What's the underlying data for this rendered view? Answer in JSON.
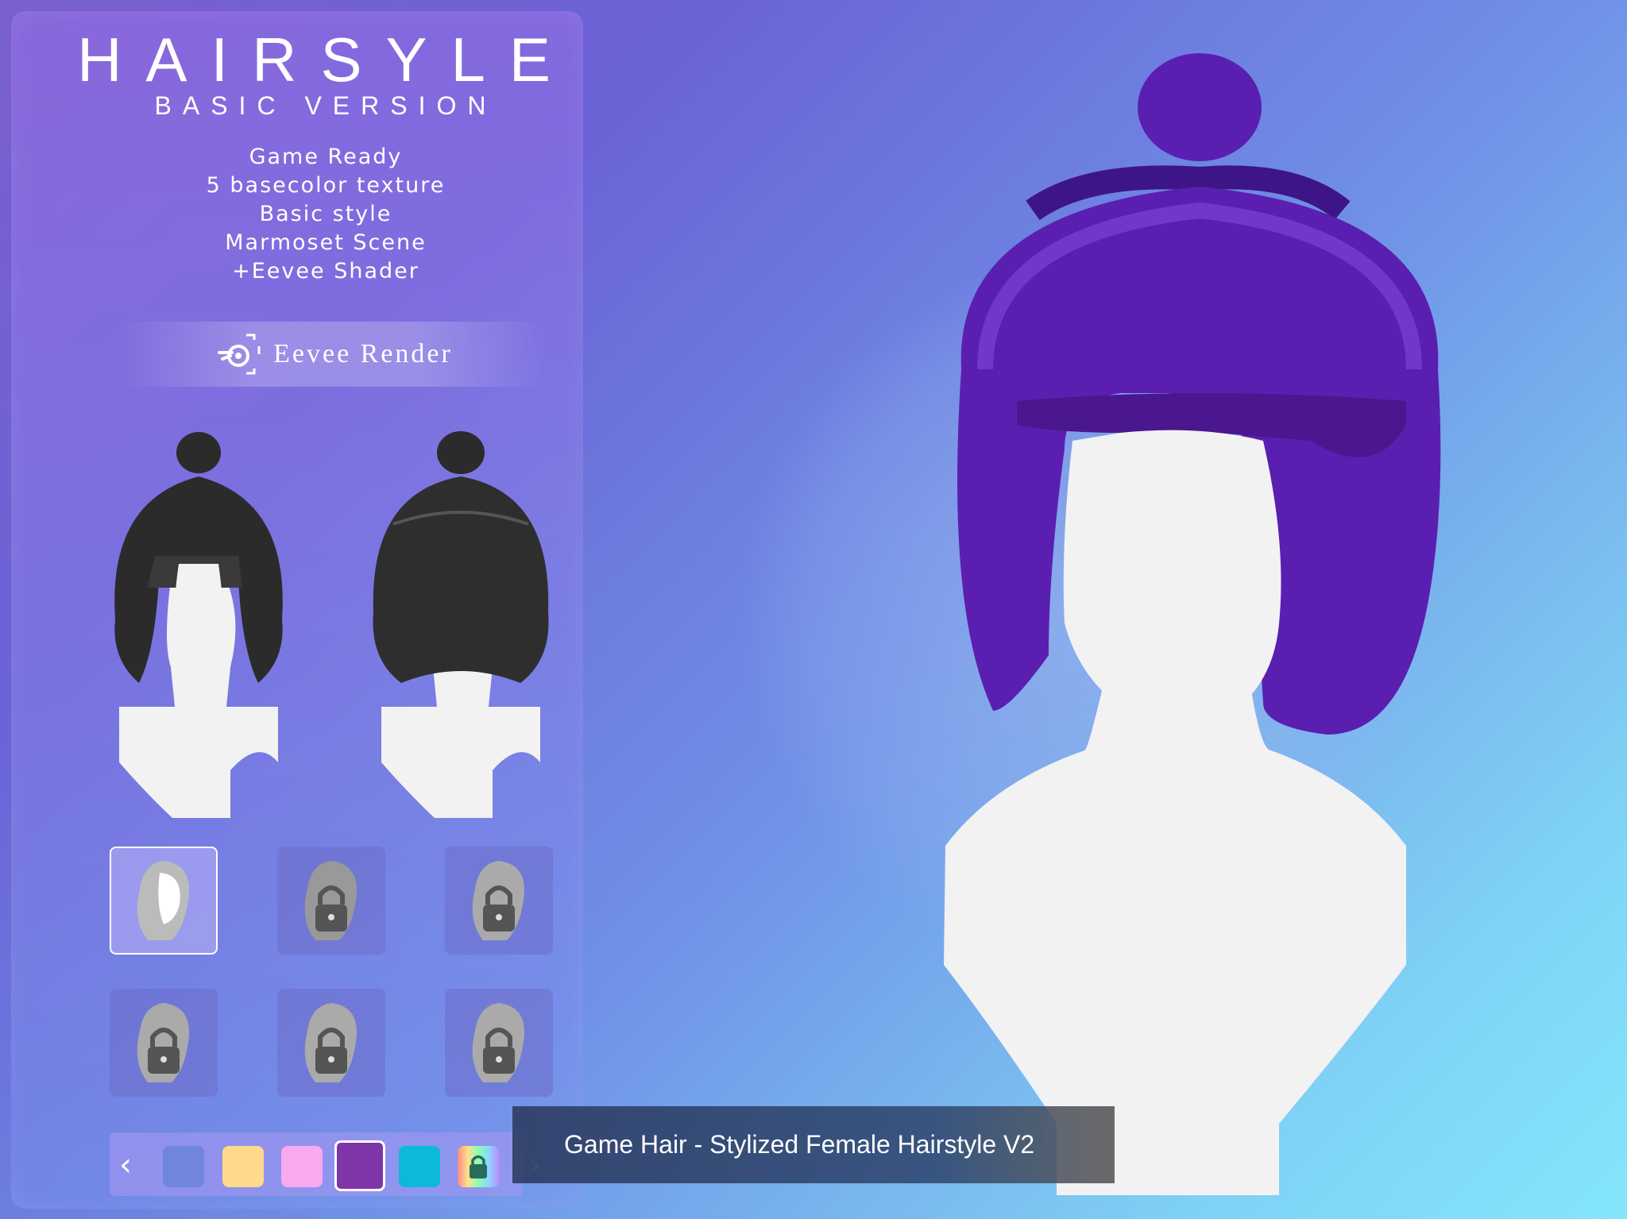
{
  "header": {
    "title": "HAIRSYLE",
    "subtitle": "BASIC VERSION"
  },
  "features": [
    "Game Ready",
    "5 basecolor texture",
    "Basic style",
    "Marmoset Scene",
    "+Eevee Shader"
  ],
  "render_banner": {
    "label": "Eevee Render",
    "icon": "blender-icon"
  },
  "views": [
    {
      "name": "front-view",
      "hair_color": "#2b2b2b"
    },
    {
      "name": "back-view",
      "hair_color": "#2b2b2b"
    }
  ],
  "style_thumbnails": [
    {
      "state": "selected",
      "locked": false
    },
    {
      "state": "locked",
      "locked": true
    },
    {
      "state": "locked",
      "locked": true
    },
    {
      "state": "locked",
      "locked": true
    },
    {
      "state": "locked",
      "locked": true
    },
    {
      "state": "locked",
      "locked": true
    }
  ],
  "swatches": [
    {
      "color": "#6f86dc",
      "selected": false
    },
    {
      "color": "#ffd98c",
      "selected": false
    },
    {
      "color": "#f9a9f0",
      "selected": false
    },
    {
      "color": "#7e35a8",
      "selected": true
    },
    {
      "color": "#0cb9d9",
      "selected": false
    },
    {
      "color": "rainbow",
      "selected": false,
      "locked": true
    }
  ],
  "main_preview": {
    "hair_color": "#5a1fb0"
  },
  "caption": {
    "text": "Game Hair - Stylized Female Hairstyle V2"
  },
  "colors": {
    "accent": "#5a1fb0",
    "panel_bg": "#8a6fe0"
  }
}
